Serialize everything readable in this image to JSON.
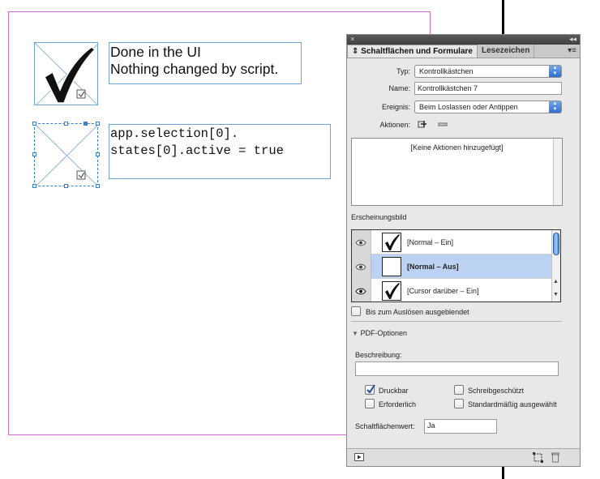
{
  "canvas": {
    "text_frame_1": {
      "lines": [
        "Done in the UI",
        "Nothing changed by script."
      ]
    },
    "text_frame_2": {
      "lines": [
        "app.selection[0].",
        "states[0].active = true"
      ]
    }
  },
  "panel": {
    "strip": {
      "close": "×",
      "collapse": "◂◂"
    },
    "tabs": [
      {
        "label": "Schaltflächen und Formulare",
        "active": true
      },
      {
        "label": "Lesezeichen",
        "active": false
      }
    ],
    "menu_icon": "panel-menu-icon",
    "type_label": "Typ:",
    "type_value": "Kontrollkästchen",
    "name_label": "Name:",
    "name_value": "Kontrollkästchen 7",
    "event_label": "Ereignis:",
    "event_value": "Beim Loslassen oder Antippen",
    "actions_label": "Aktionen:",
    "actions_empty": "[Keine Aktionen hinzugefügt]",
    "appearance_title": "Erscheinungsbild",
    "appearances": [
      {
        "label": "[Normal – Ein]",
        "checked": true,
        "selected": false
      },
      {
        "label": "[Normal – Aus]",
        "checked": false,
        "selected": true
      },
      {
        "label": "[Cursor darüber – Ein]",
        "checked": true,
        "selected": false
      }
    ],
    "hidden_until_label": "Bis zum Auslösen ausgeblendet",
    "pdf_options_label": "PDF-Optionen",
    "description_label": "Beschreibung:",
    "description_value": "",
    "printable_label": "Druckbar",
    "printable_checked": true,
    "readonly_label": "Schreibgeschützt",
    "readonly_checked": false,
    "required_label": "Erforderlich",
    "required_checked": false,
    "default_selected_label": "Standardmäßig ausgewählt",
    "default_selected_checked": false,
    "button_value_label": "Schaltflächenwert:",
    "button_value": "Ja"
  },
  "colors": {
    "frame_blue": "#6fa5d6",
    "page_border": "#d56bd0",
    "selection_blue": "#3b7fcf",
    "list_selected": "#bcd2f2"
  }
}
